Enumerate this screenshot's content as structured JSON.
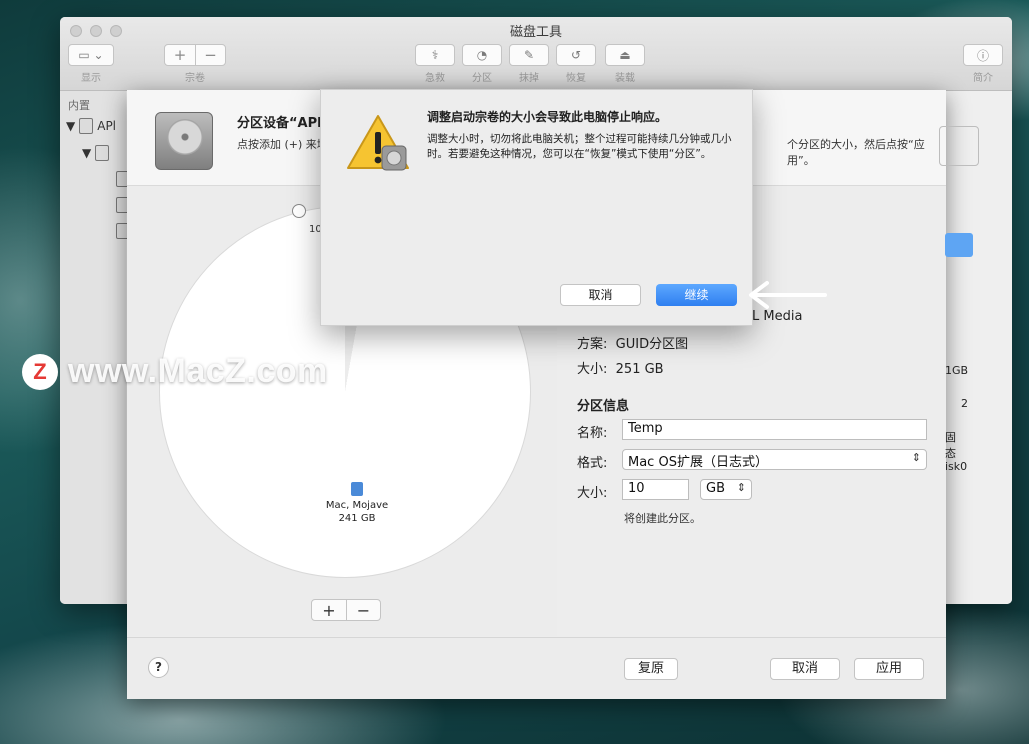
{
  "window": {
    "title": "磁盘工具"
  },
  "toolbar": {
    "display_label": "显示",
    "volume_label": "宗卷",
    "first_aid_label": "急救",
    "partition_label": "分区",
    "erase_label": "抹掉",
    "restore_label": "恢复",
    "mount_label": "装载",
    "info_label": "简介",
    "add_glyph": "+",
    "remove_glyph": "−"
  },
  "sidebar": {
    "header": "内置",
    "disk_name_partial": "APl"
  },
  "partition_sheet": {
    "title": "分区设备“APl",
    "description_left": "点按添加 (+) 来增",
    "description_right": "个分区的大小，然后点按“应用”。",
    "pie_small_label": "10",
    "volume_name": "Mac, Mojave",
    "volume_size": "241 GB",
    "media_partial": "L Media",
    "scheme_label": "方案:",
    "scheme_value": "GUID分区图",
    "size_label": "大小:",
    "size_value": "251 GB",
    "partition_info_heading": "分区信息",
    "name_label": "名称:",
    "name_value": "Temp",
    "format_label": "格式:",
    "format_value": "Mac OS扩展（日志式）",
    "part_size_label": "大小:",
    "part_size_value": "10",
    "part_size_unit": "GB",
    "note": "将创建此分区。",
    "right_values": [
      "1GB",
      "2",
      "固态",
      "isk0"
    ],
    "help": "?",
    "revert": "复原",
    "cancel": "取消",
    "apply": "应用",
    "add": "+",
    "remove": "−"
  },
  "alert": {
    "title": "调整启动宗卷的大小会导致此电脑停止响应。",
    "body": "调整大小时，切勿将此电脑关机；整个过程可能持续几分钟或几小时。若要避免这种情况，您可以在“恢复”模式下使用“分区”。",
    "cancel": "取消",
    "continue": "继续"
  },
  "watermark": {
    "logo": "Z",
    "text": "www.MacZ.com"
  },
  "colors": {
    "accent": "#3a8cf5",
    "window_bg": "#ececec"
  }
}
